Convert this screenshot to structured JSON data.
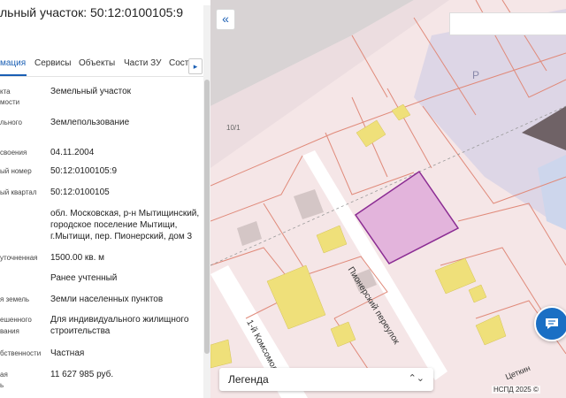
{
  "panel": {
    "title": "льный участок: 50:12:0100105:9",
    "tabs": [
      {
        "label": "мация",
        "active": true
      },
      {
        "label": "Сервисы",
        "active": false
      },
      {
        "label": "Объекты",
        "active": false
      },
      {
        "label": "Части ЗУ",
        "active": false
      },
      {
        "label": "Сост",
        "active": false
      }
    ],
    "tab_next_label": "▸",
    "fields": [
      {
        "label": "кта",
        "label2": "мости",
        "value": "Земельный участок"
      },
      {
        "label": "льного",
        "value": "Землепользование"
      },
      {
        "label": "своения",
        "value": "04.11.2004"
      },
      {
        "label": "ый номер",
        "value": "50:12:0100105:9"
      },
      {
        "label": "ый квартал",
        "value": "50:12:0100105"
      },
      {
        "label": "",
        "value": "обл. Московская, р-н Мытищинский,",
        "value2": "городское поселение Мытищи,",
        "value3": "г.Мытищи, пер. Пионерский, дом 3"
      },
      {
        "label": "уточненная",
        "value": "1500.00 кв. м"
      },
      {
        "label": "",
        "value": "Ранее учтенный"
      },
      {
        "label": "я земель",
        "value": "Земли населенных пунктов"
      },
      {
        "label": "ешенного",
        "label2": "вания",
        "value": "Для индивидуального жилищного",
        "value2": "строительства"
      },
      {
        "label": "бственности",
        "value": "Частная"
      },
      {
        "label": "ая",
        "label2": "ь",
        "value": "11 627 985 руб."
      }
    ]
  },
  "map": {
    "collapse_label": "«",
    "legend_label": "Легенда",
    "legend_chevron": "⌃⌄",
    "chat_icon": "speech-bubble-icon",
    "copyright": "НСПД 2025 ©",
    "street_labels": [
      "Пионерский переулок",
      "1-й Комсомол",
      "Цеткин"
    ],
    "parcel_label": "10/1",
    "parking_label": "P",
    "colors": {
      "parcel_fill": "#e3b4dc",
      "parcel_border": "#8b2c93",
      "building": "#efe07a",
      "lines": "#e08a7a"
    }
  }
}
